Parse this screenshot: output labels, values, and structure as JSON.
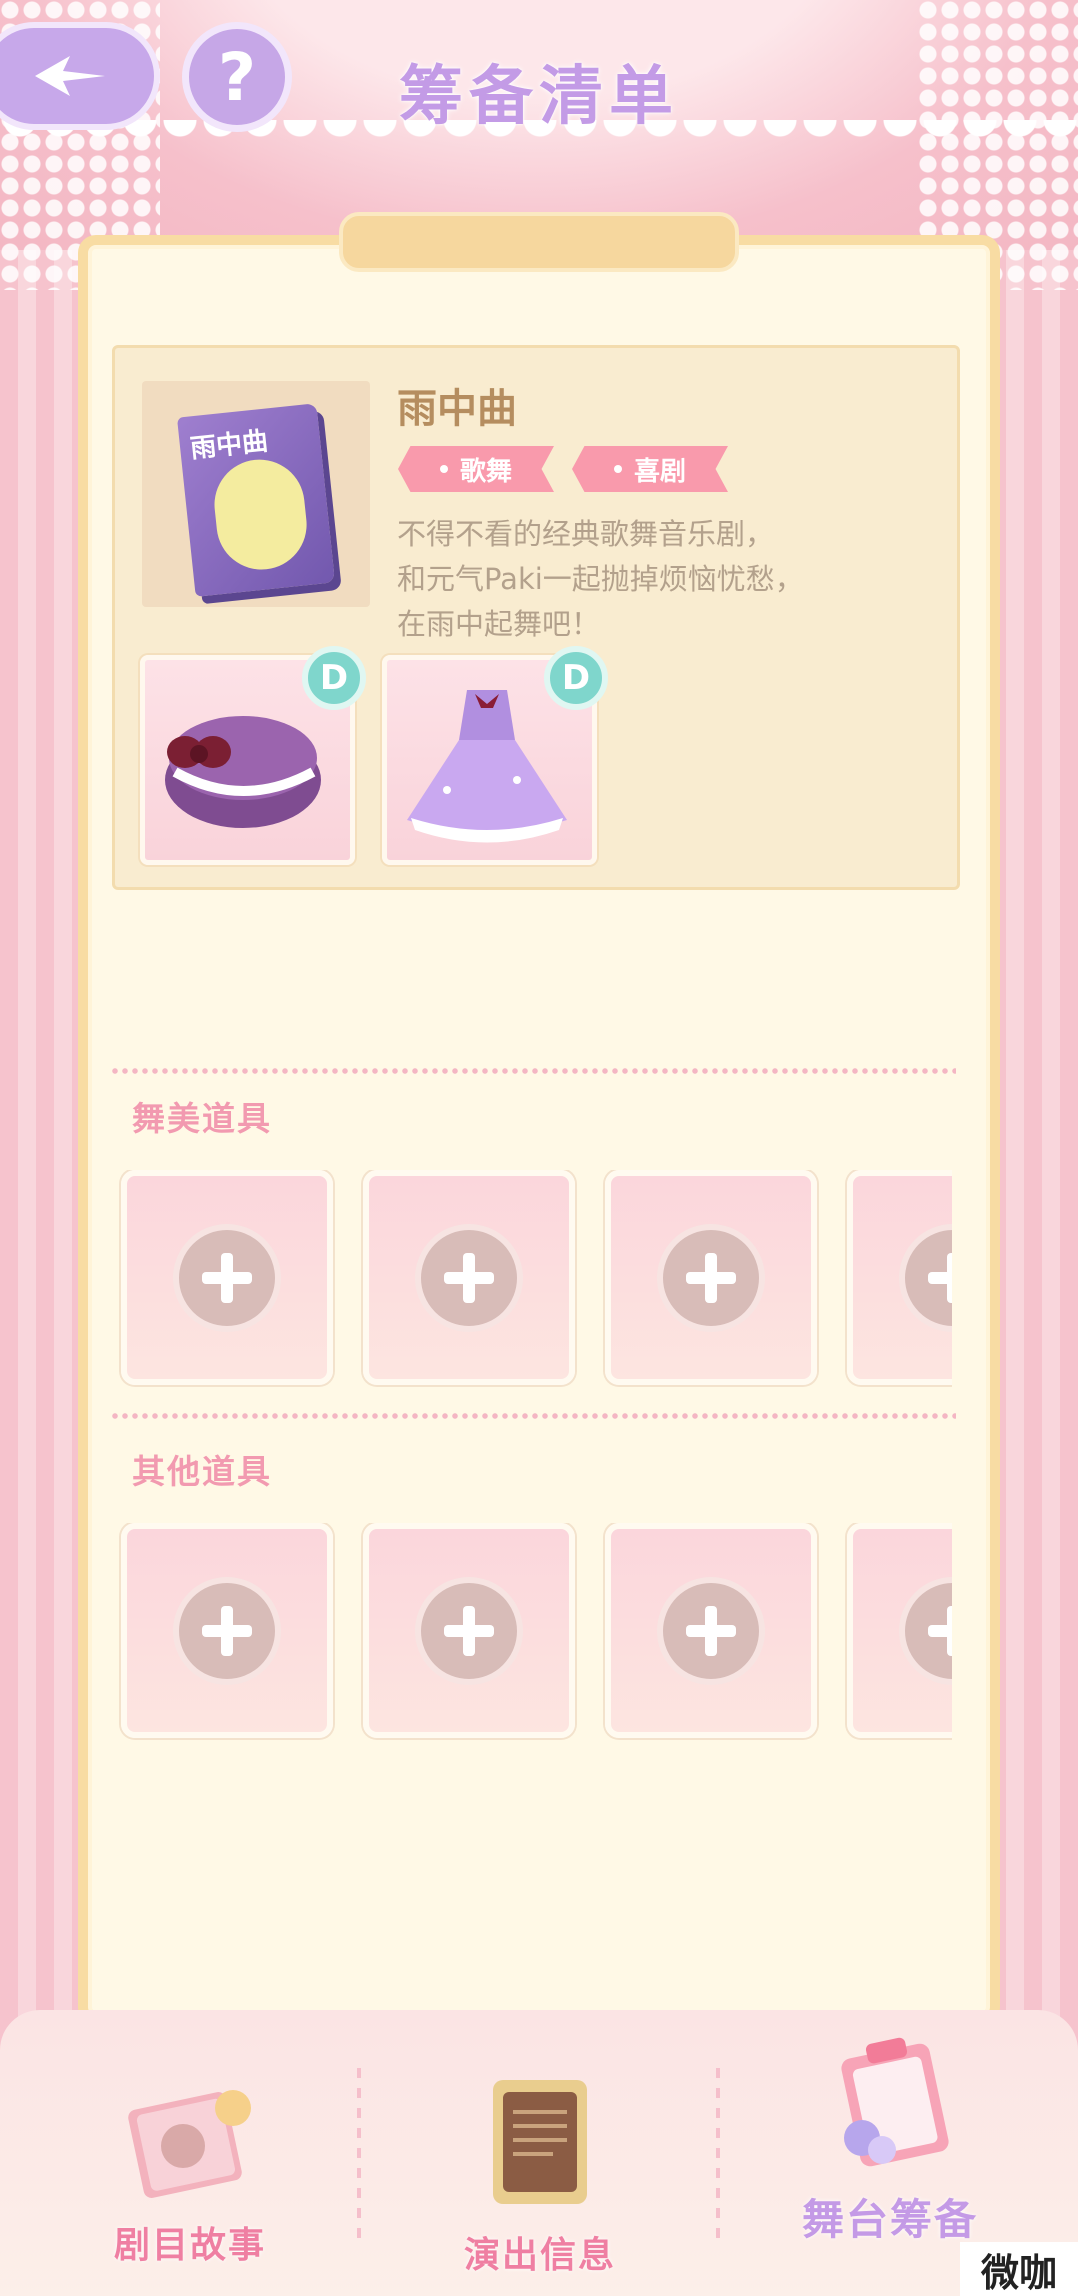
{
  "header": {
    "title": "筹备清单"
  },
  "script": {
    "cover_title": "雨中曲",
    "title": "雨中曲",
    "tags": [
      "歌舞",
      "喜剧"
    ],
    "description_lines": [
      "不得不看的经典歌舞音乐剧，",
      "和元气Paki一起抛掉烦恼忧愁，",
      "在雨中起舞吧！"
    ],
    "costumes": [
      {
        "icon": "macaron-hat-icon",
        "grade": "D"
      },
      {
        "icon": "purple-dress-icon",
        "grade": "D"
      }
    ]
  },
  "sections": [
    {
      "label": "舞美道具"
    },
    {
      "label": "其他道具"
    }
  ],
  "nav": {
    "story": "剧目故事",
    "info": "演出信息",
    "stage": "舞台筹备"
  },
  "watermark": "微咖",
  "colors": {
    "title_purple": "#c39be6",
    "section_pink": "#f29ab0",
    "tag_pink": "#f99aac",
    "panel_cream": "#fff9e6"
  }
}
